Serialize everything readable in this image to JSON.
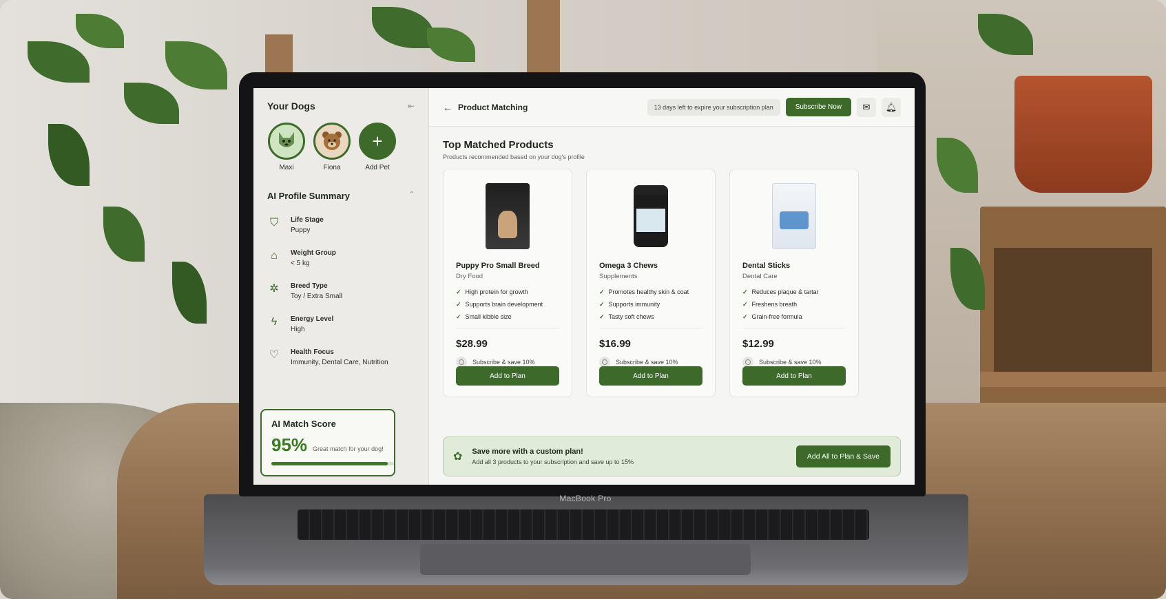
{
  "device_label": "MacBook Pro",
  "colors": {
    "brand_green": "#3d6a2b",
    "score_green": "#3a7a23",
    "promo_bg": "#e1ebd9"
  },
  "sidebar": {
    "title": "Your Dogs",
    "collapse_icon": "sidebar-toggle-icon",
    "pets": [
      {
        "name": "Maxi",
        "icon": "dog-avatar"
      },
      {
        "name": "Fiona",
        "icon": "dog-avatar"
      },
      {
        "name": "Add Pet",
        "icon": "plus-icon"
      }
    ],
    "profile": {
      "title": "AI Profile Summary",
      "attributes": [
        {
          "label": "Life Stage",
          "value": "Puppy",
          "icon": "paw-badge-icon"
        },
        {
          "label": "Weight Group",
          "value": "< 5 kg",
          "icon": "scale-icon"
        },
        {
          "label": "Breed Type",
          "value": "Toy / Extra Small",
          "icon": "breed-icon"
        },
        {
          "label": "Energy Level",
          "value": "High",
          "icon": "lightning-icon"
        },
        {
          "label": "Health Focus",
          "value": "Immunity, Dental Care, Nutrition",
          "icon": "heart-shield-icon"
        }
      ]
    },
    "match": {
      "title": "AI Match Score",
      "score": "95%",
      "score_fraction": 0.95,
      "subtitle": "Great match for your dog!"
    }
  },
  "topbar": {
    "title": "Product Matching",
    "subscription_notice": "13 days left to expire your subscription plan",
    "subscribe_label": "Subscribe Now"
  },
  "content": {
    "title": "Top Matched Products",
    "subtitle": "Products recommended based on your dog's profile",
    "products": [
      {
        "name": "Puppy Pro Small Breed",
        "category": "Dry Food",
        "features": [
          "High protein for growth",
          "Supports brain development",
          "Small kibble size"
        ],
        "price": "$28.99",
        "subscribe": "Subscribe & save 10%",
        "button": "Add to Plan"
      },
      {
        "name": "Omega 3 Chews",
        "category": "Supplements",
        "features": [
          "Promotes healthy skin & coat",
          "Supports immunity",
          "Tasty soft chews"
        ],
        "price": "$16.99",
        "subscribe": "Subscribe & save 10%",
        "button": "Add to Plan"
      },
      {
        "name": "Dental Sticks",
        "category": "Dental Care",
        "features": [
          "Reduces plaque & tartar",
          "Freshens breath",
          "Grain-free formula"
        ],
        "price": "$12.99",
        "subscribe": "Subscribe & save 10%",
        "button": "Add to Plan"
      }
    ],
    "promo": {
      "title": "Save more with a custom plan!",
      "subtitle": "Add all 3 products to your subscription and save up to 15%",
      "button": "Add All to Plan & Save"
    }
  }
}
